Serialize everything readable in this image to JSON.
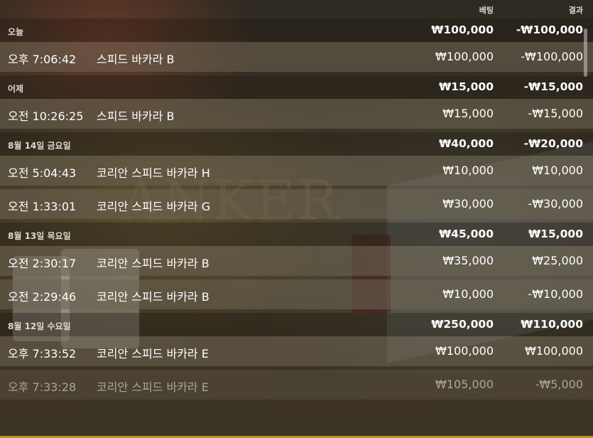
{
  "columns": {
    "bet": "베팅",
    "result": "결과"
  },
  "groups": [
    {
      "label": "오늘",
      "bet": "₩100,000",
      "result": "-₩100,000",
      "rows": [
        {
          "time": "오후 7:06:42",
          "game": "스피드 바카라 B",
          "bet": "₩100,000",
          "result": "-₩100,000"
        }
      ]
    },
    {
      "label": "어제",
      "bet": "₩15,000",
      "result": "-₩15,000",
      "rows": [
        {
          "time": "오전 10:26:25",
          "game": "스피드 바카라 B",
          "bet": "₩15,000",
          "result": "-₩15,000"
        }
      ]
    },
    {
      "label": "8월 14일 금요일",
      "bet": "₩40,000",
      "result": "-₩20,000",
      "rows": [
        {
          "time": "오전 5:04:43",
          "game": "코리안 스피드 바카라 H",
          "bet": "₩10,000",
          "result": "₩10,000"
        },
        {
          "time": "오전 1:33:01",
          "game": "코리안 스피드 바카라 G",
          "bet": "₩30,000",
          "result": "-₩30,000"
        }
      ]
    },
    {
      "label": "8월 13일 목요일",
      "bet": "₩45,000",
      "result": "₩15,000",
      "rows": [
        {
          "time": "오전 2:30:17",
          "game": "코리안 스피드 바카라 B",
          "bet": "₩35,000",
          "result": "₩25,000"
        },
        {
          "time": "오전 2:29:46",
          "game": "코리안 스피드 바카라 B",
          "bet": "₩10,000",
          "result": "-₩10,000"
        }
      ]
    },
    {
      "label": "8월 12일 수요일",
      "bet": "₩250,000",
      "result": "₩110,000",
      "rows": [
        {
          "time": "오후 7:33:52",
          "game": "코리안 스피드 바카라 E",
          "bet": "₩100,000",
          "result": "₩100,000"
        },
        {
          "time": "오후 7:33:28",
          "game": "코리안 스피드 바카라 E",
          "bet": "₩105,000",
          "result": "-₩5,000"
        }
      ]
    }
  ],
  "background_text": "ANKER",
  "colors": {
    "accent": "#b8962e"
  }
}
